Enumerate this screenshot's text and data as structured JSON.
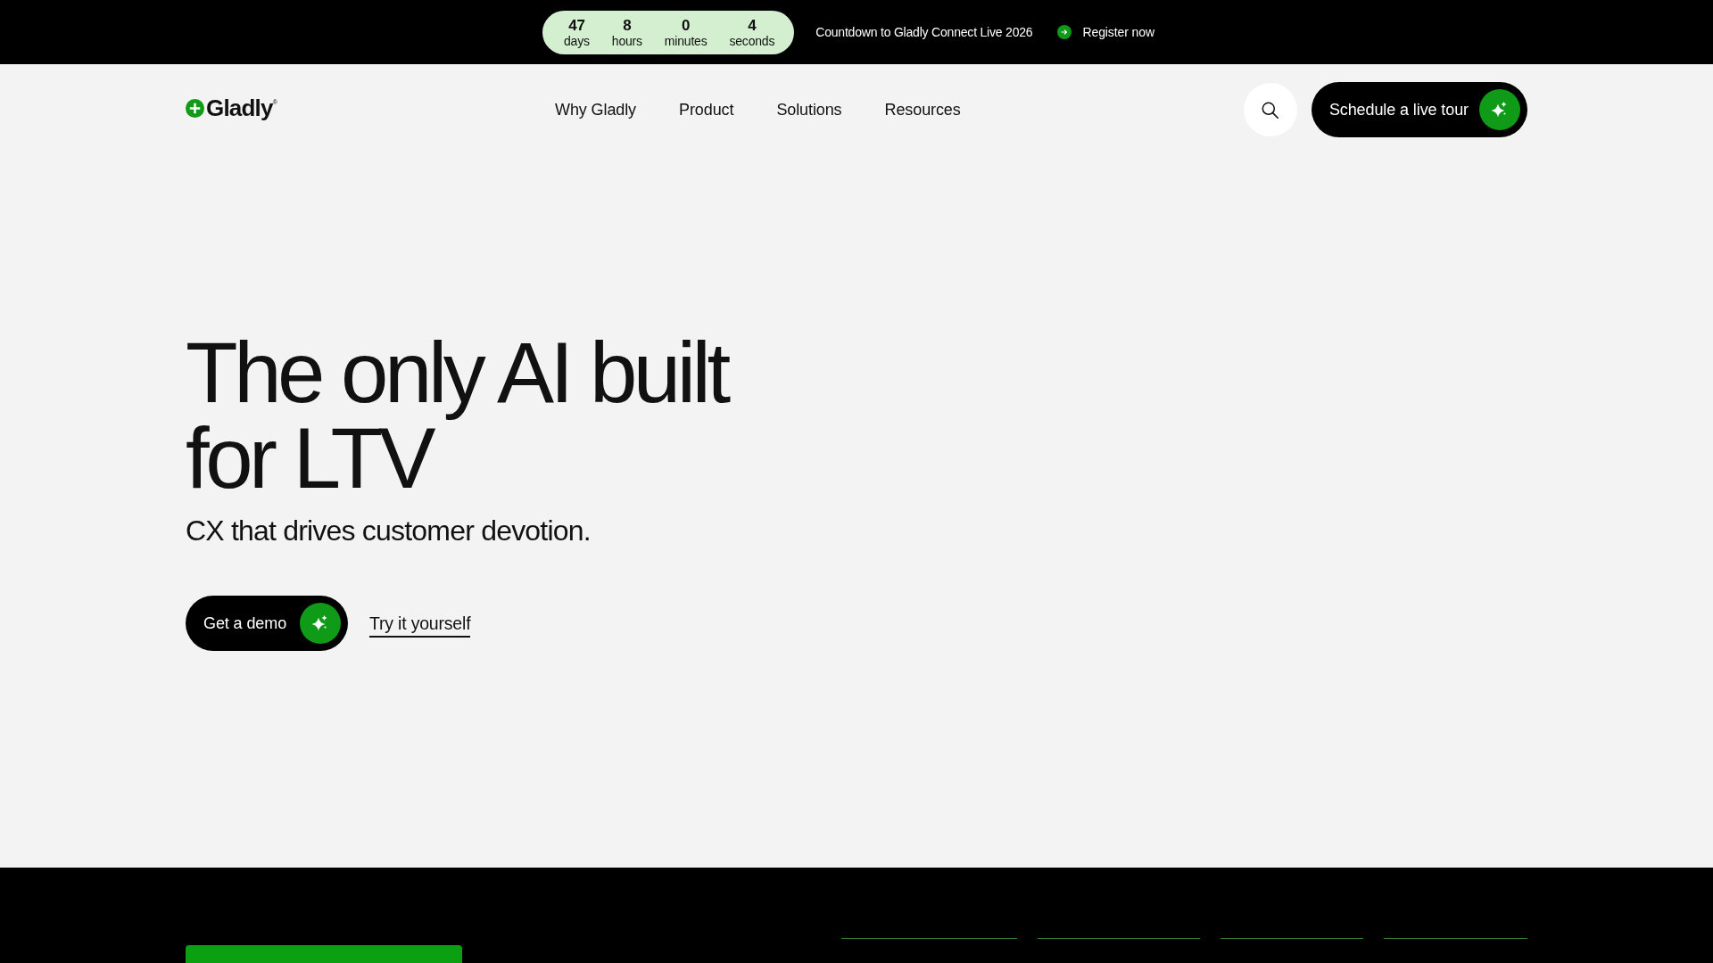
{
  "announcement_bar": {
    "countdown": [
      {
        "value": "47",
        "unit": "days"
      },
      {
        "value": "8",
        "unit": "hours"
      },
      {
        "value": "0",
        "unit": "minutes"
      },
      {
        "value": "4",
        "unit": "seconds"
      }
    ],
    "message": "Countdown to Gladly Connect Live 2026",
    "link": "Register now"
  },
  "header": {
    "logo": "Gladly$^{®}$",
    "nav": [
      "Why Gladly",
      "Product",
      "Solutions",
      "Resources"
    ],
    "cta": "Schedule a live tour"
  },
  "hero": {
    "heading": "The only AI built for LTV",
    "subheading": "CX that drives customer devotion.",
    "primary_button": "Get a demo",
    "secondary_link": "Try it yourself"
  }
}
